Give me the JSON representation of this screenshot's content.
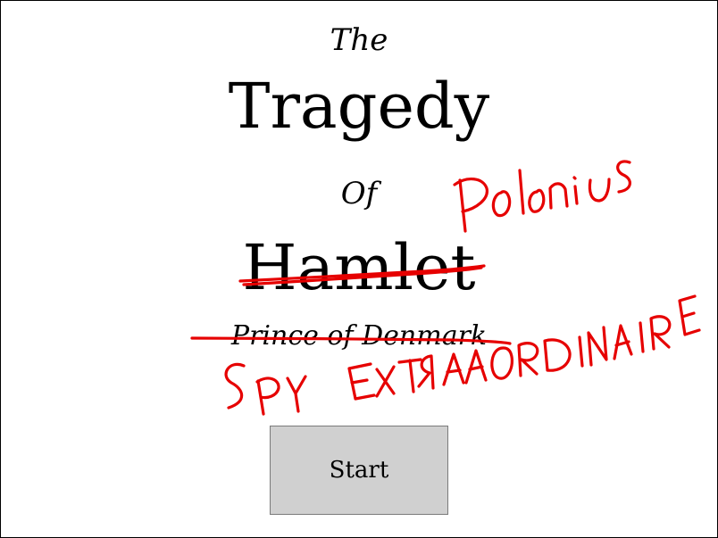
{
  "title": {
    "the": "The",
    "tragedy": "Tragedy",
    "of": "Of",
    "hamlet": "Hamlet",
    "subtitle": "Prince of Denmark"
  },
  "scribbles": {
    "name": "Polonius",
    "subtitle": "SPY EXTRAORDINAIRE",
    "ink_color": "#e60000"
  },
  "start_button": {
    "label": "Start"
  }
}
